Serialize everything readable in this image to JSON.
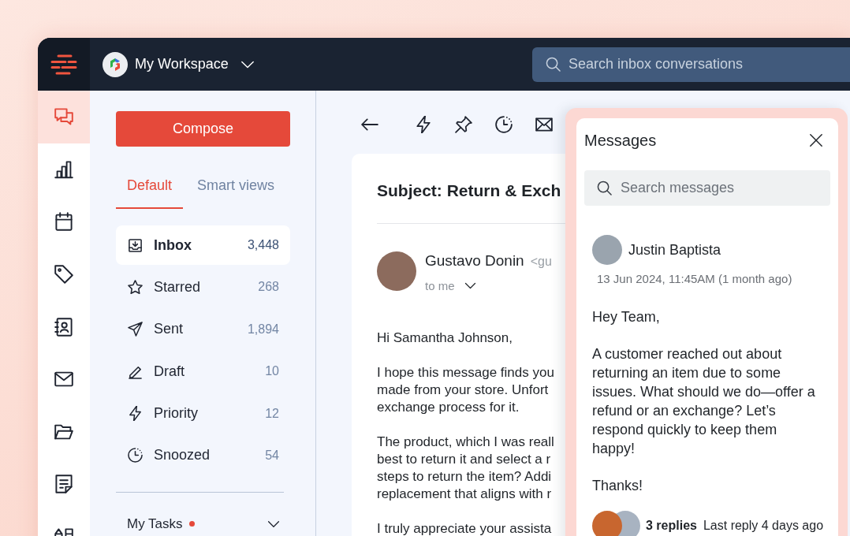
{
  "top_bar": {
    "workspace": {
      "name": "My Workspace"
    },
    "search": {
      "placeholder": "Search inbox conversations"
    }
  },
  "nav_rail": {
    "items": [
      {
        "selected": true
      },
      {
        "selected": false
      },
      {
        "selected": false
      },
      {
        "selected": false
      },
      {
        "selected": false
      },
      {
        "selected": false
      },
      {
        "selected": false
      },
      {
        "selected": false
      },
      {
        "selected": false
      }
    ]
  },
  "sidebar": {
    "compose_button": {
      "label": "Compose"
    },
    "tabs": [
      {
        "label": "Default",
        "selected": true
      },
      {
        "label": "Smart views",
        "selected": false
      }
    ],
    "folders": [
      {
        "label": "Inbox",
        "count": "3,448",
        "selected": true
      },
      {
        "label": "Starred",
        "count": "268",
        "selected": false
      },
      {
        "label": "Sent",
        "count": "1,894",
        "selected": false
      },
      {
        "label": "Draft",
        "count": "10",
        "selected": false
      },
      {
        "label": "Priority",
        "count": "12",
        "selected": false
      },
      {
        "label": "Snoozed",
        "count": "54",
        "selected": false
      }
    ],
    "my_tasks": {
      "label": "My Tasks",
      "unread": true
    }
  },
  "email": {
    "subject": "Subject: Return & Exch",
    "sender": {
      "name": "Gustavo Donin",
      "address": "<gu"
    },
    "recipient": "to me",
    "body": [
      [
        "Hi Samantha Johnson,"
      ],
      [
        "I hope this message finds you",
        "made from your store. Unfort",
        "exchange process for it."
      ],
      [
        "The product, which I was reall",
        "best to return it and select a r",
        "steps to return the item? Addi",
        "replacement that aligns with r"
      ],
      [
        "I truly appreciate your assista"
      ]
    ]
  },
  "messages_panel": {
    "title": "Messages",
    "search": {
      "placeholder": "Search messages"
    },
    "message": {
      "author": "Justin Baptista",
      "timestamp": "13 Jun 2024, 11:45AM (1 month ago)",
      "body": [
        "Hey Team,",
        "A customer reached out about returning an item due to some issues. What should we do—offer a refund or an exchange? Let’s respond quickly to keep them happy!",
        "Thanks!"
      ],
      "replies": {
        "count": "3 replies",
        "last_reply": "Last reply 4 days ago"
      }
    }
  }
}
